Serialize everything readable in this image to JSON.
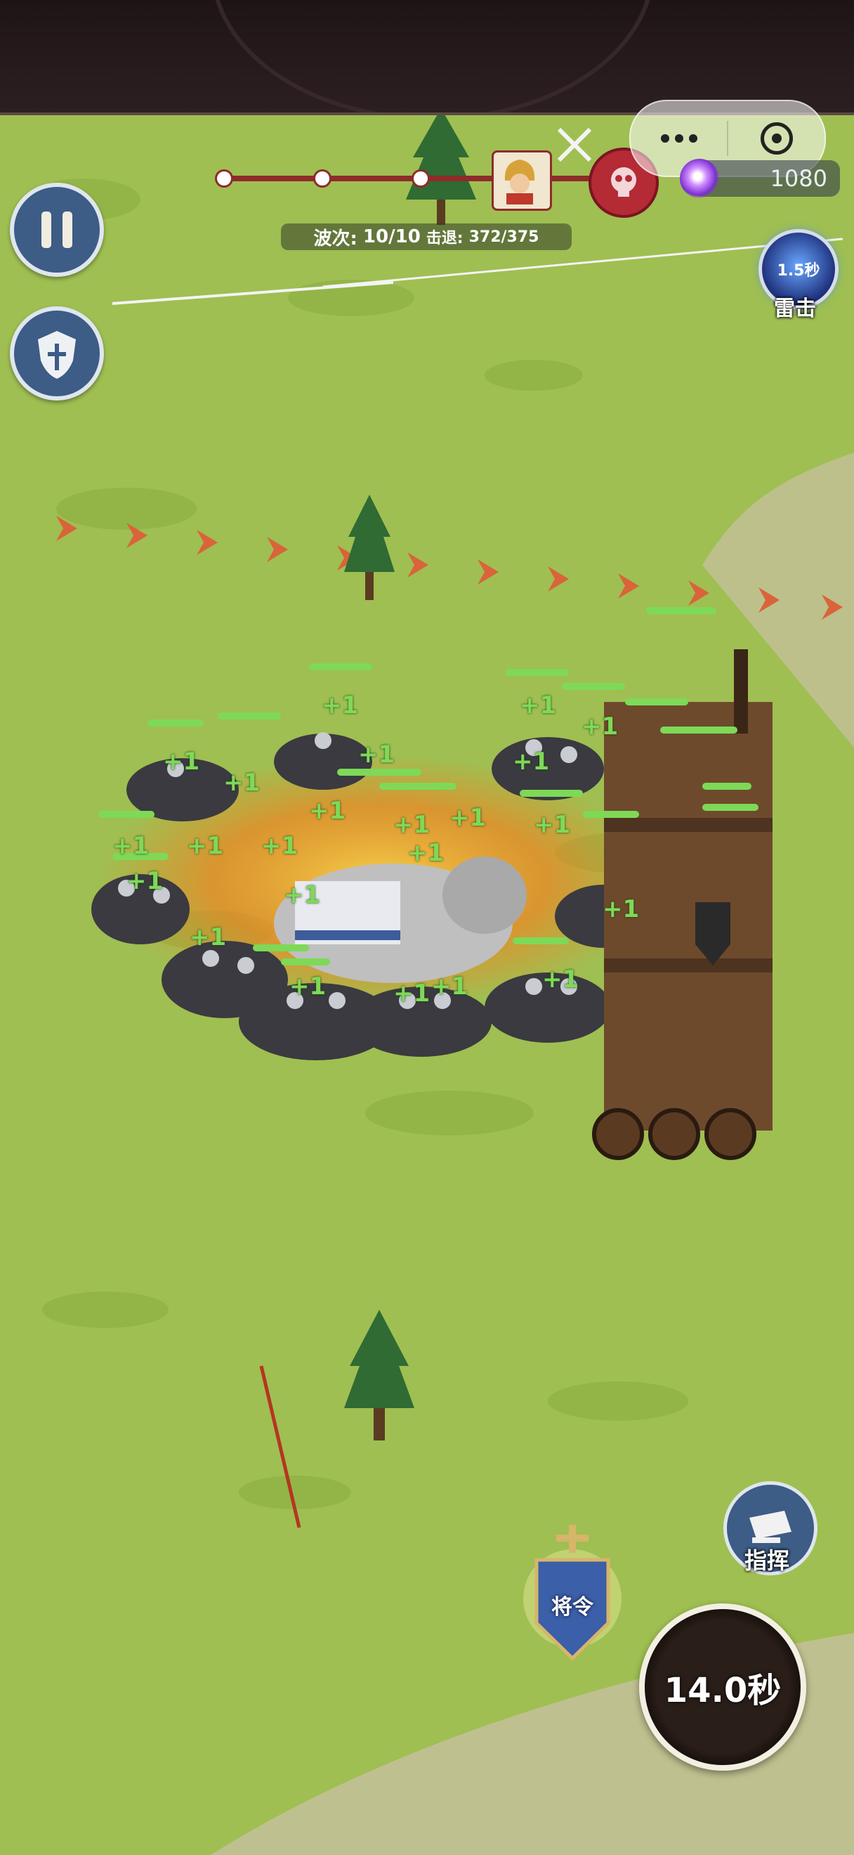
{
  "hud": {
    "wave_label": "波次:",
    "wave_value": "10/10",
    "kills_label": "击退:",
    "kills_value": "372/375",
    "gem_count": "1080",
    "wave_progress_nodes": 3
  },
  "skill": {
    "cooldown": "1.5秒",
    "label": "雷击",
    "icon": "lightning-icon"
  },
  "controls": {
    "command_label": "指挥",
    "order_banner_label": "将令",
    "timer_text": "14.0秒",
    "pause_icon": "pause-icon",
    "guild_icon": "shield-sword-icon"
  },
  "battle": {
    "floating_text": "+1"
  },
  "colors": {
    "grass": "#9fbf52",
    "track": "#8e2b2b",
    "button_blue": "#3d5c86",
    "health_green": "#7ed957"
  }
}
